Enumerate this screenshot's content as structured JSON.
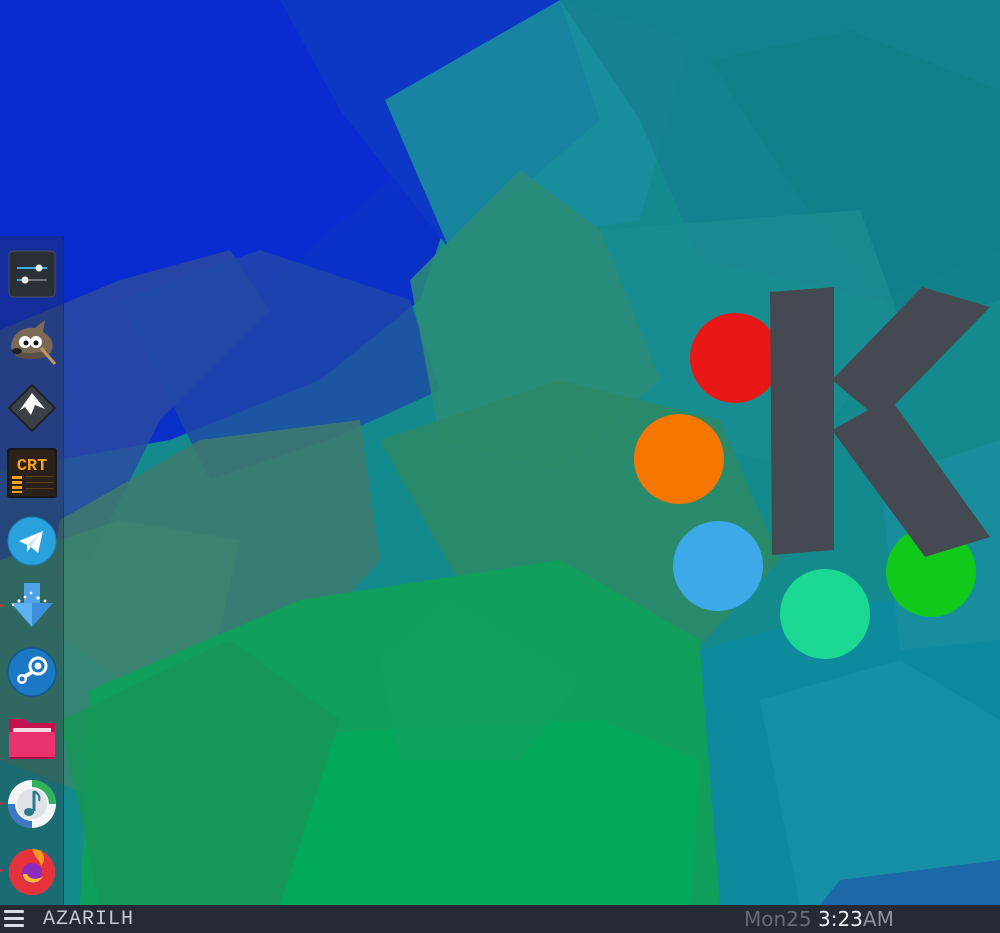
{
  "wallpaper": {
    "logo_letter": "K",
    "colors": {
      "blue": "#0b33c8",
      "teal": "#13898f",
      "green": "#0aa55a",
      "logo_gray": "#454a52",
      "dot_red": "#ea1717",
      "dot_orange": "#f57600",
      "dot_blue": "#3ea9e8",
      "dot_mint": "#1bd893",
      "dot_green": "#10c91a"
    }
  },
  "dock": {
    "items": [
      {
        "name": "settings-sliders-icon",
        "running": false
      },
      {
        "name": "gimp-icon",
        "running": false
      },
      {
        "name": "inkscape-icon",
        "running": false
      },
      {
        "name": "cool-retro-term-icon",
        "label": "CRT",
        "running": false
      },
      {
        "name": "telegram-icon",
        "running": false
      },
      {
        "name": "downloader-icon",
        "running": true
      },
      {
        "name": "steam-icon",
        "running": false
      },
      {
        "name": "folder-icon",
        "running": false
      },
      {
        "name": "music-player-icon",
        "running": true
      },
      {
        "name": "firefox-icon",
        "running": true
      }
    ]
  },
  "taskbar": {
    "hostname": "AZARILH",
    "clock": {
      "day": "Mon25",
      "time": "3:23",
      "ampm": "AM"
    }
  }
}
